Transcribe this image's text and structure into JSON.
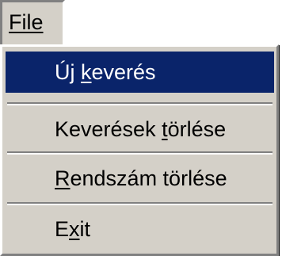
{
  "menubar": {
    "file_menu": {
      "label": "File"
    }
  },
  "dropdown": {
    "items": [
      {
        "pre": "Új ",
        "key": "k",
        "post": "everés",
        "selected": true
      },
      {
        "pre": "Keverések ",
        "key": "t",
        "post": "örlése",
        "selected": false
      },
      {
        "pre": "",
        "key": "R",
        "post": "endszám törlése",
        "selected": false
      },
      {
        "pre": "E",
        "key": "x",
        "post": "it",
        "selected": false
      }
    ]
  },
  "colors": {
    "menu_face": "#d4d0c8",
    "highlight": "#0a246a",
    "highlight_text": "#ffffff",
    "shadow": "#808080"
  }
}
